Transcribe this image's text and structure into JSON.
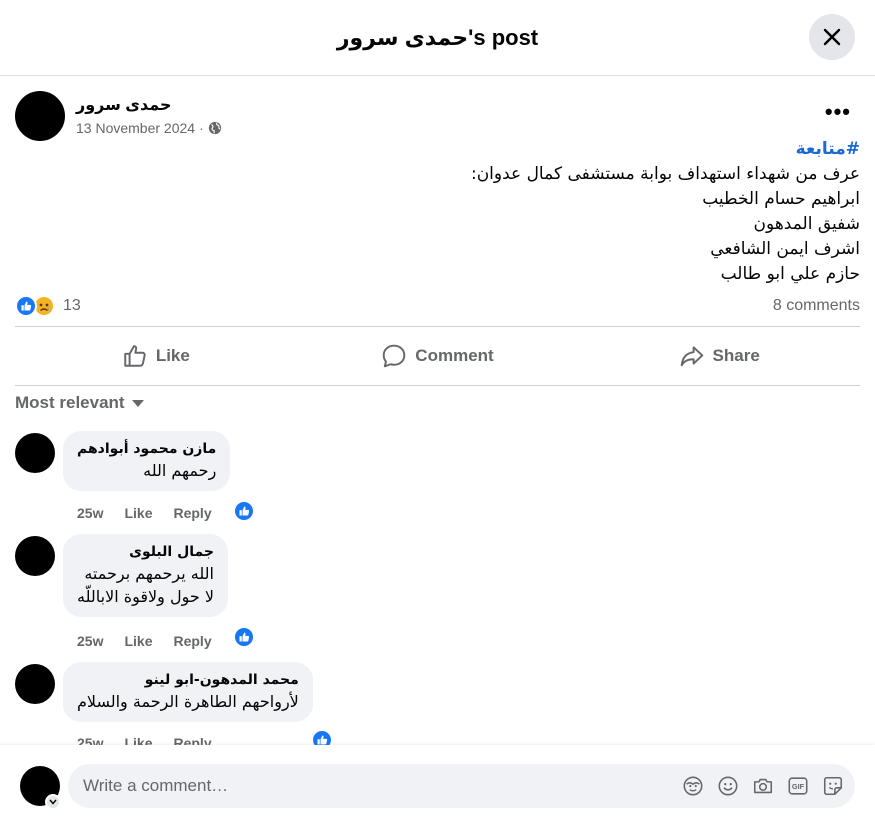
{
  "header": {
    "title": "حمدى سرور's post"
  },
  "post": {
    "author": "حمدى سرور",
    "date": "13 November 2024",
    "separator": "·",
    "more": "•••",
    "hashtag": "#متابعة",
    "lines": [
      "عرف  من شهداء استهداف بوابة مستشفى كمال عدوان:",
      " ابراهيم حسام الخطيب",
      "شفيق المدهون",
      "اشرف ايمن الشافعي",
      "حازم علي ابو طالب"
    ],
    "reaction_count": "13",
    "comments_label": "8 comments"
  },
  "actions": {
    "like": "Like",
    "comment": "Comment",
    "share": "Share"
  },
  "sort": {
    "label": "Most relevant"
  },
  "comments": [
    {
      "name": "مازن محمود أبوادهم",
      "lines": [
        "رحمهم الله"
      ],
      "age": "25w",
      "like": "Like",
      "reply": "Reply"
    },
    {
      "name": "جمال البلوى",
      "lines": [
        "الله يرحمهم برحمته",
        "لا حول ولاقوة الاباللّه"
      ],
      "age": "25w",
      "like": "Like",
      "reply": "Reply"
    },
    {
      "name": "محمد المدهون-ابو لينو",
      "lines": [
        "لأرواحهم الطاهرة الرحمة والسلام"
      ],
      "age": "25w",
      "like": "Like",
      "reply": "Reply"
    }
  ],
  "composer": {
    "placeholder": "Write a comment…"
  },
  "colors": {
    "accent": "#1877f2",
    "hashtag": "#1a69d6",
    "muted": "#65676b",
    "bubble": "#f0f2f5"
  },
  "icons": [
    "close-icon",
    "globe-icon",
    "thumbs-up-icon",
    "comment-icon",
    "share-icon",
    "caret-down-icon",
    "avatar-sticker-icon",
    "emoji-icon",
    "camera-icon",
    "gif-icon",
    "sticker-icon"
  ]
}
